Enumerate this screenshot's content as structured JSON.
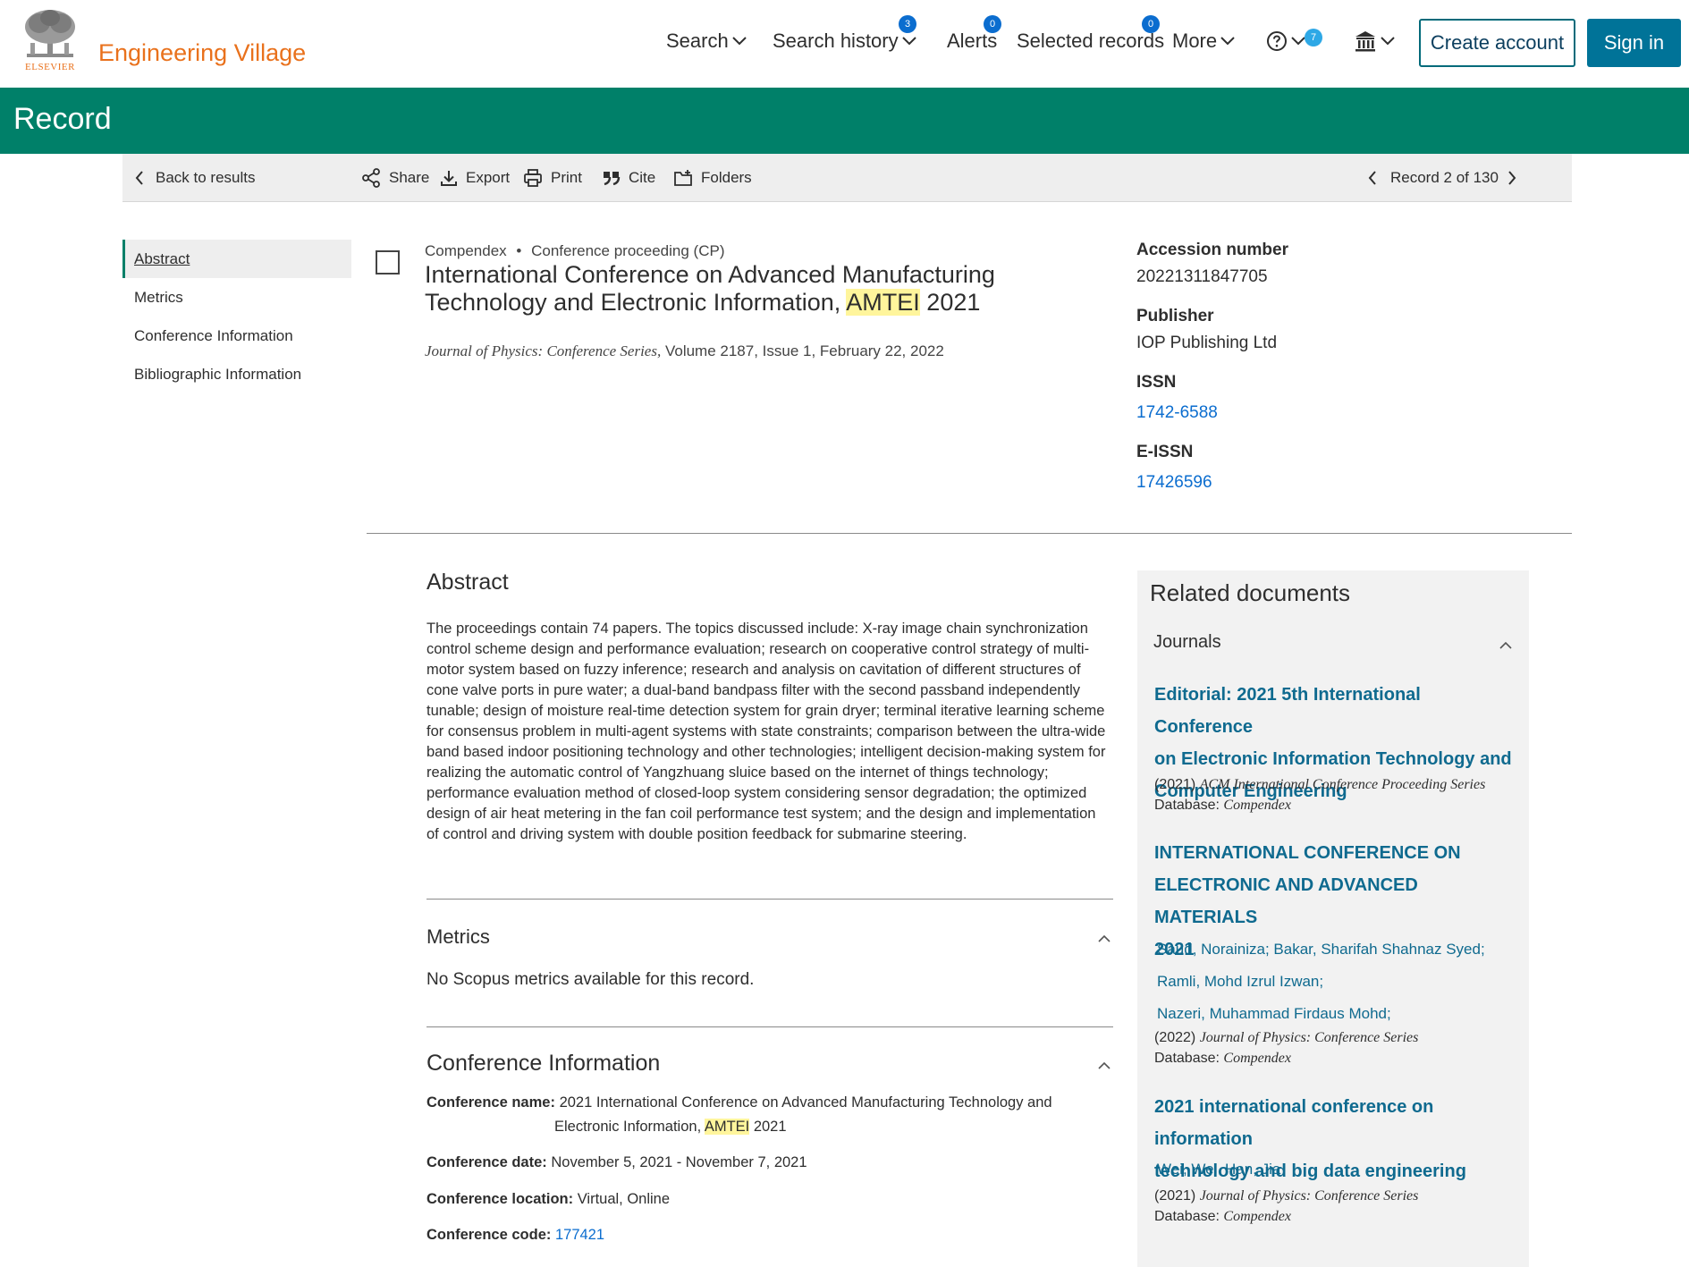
{
  "header": {
    "logo_text": "ELSEVIER",
    "brand": "Engineering Village",
    "nav": {
      "search": "Search",
      "search_history": "Search history",
      "search_history_badge": "3",
      "alerts": "Alerts",
      "alerts_badge": "0",
      "selected_records": "Selected records",
      "selected_records_badge": "0",
      "more": "More",
      "help_badge": "7"
    },
    "create_account": "Create account",
    "sign_in": "Sign in"
  },
  "band": {
    "title": "Record"
  },
  "toolbar": {
    "back": "Back to results",
    "share": "Share",
    "export": "Export",
    "print": "Print",
    "cite": "Cite",
    "folders": "Folders",
    "record_position": "Record 2 of 130"
  },
  "sidenav": {
    "items": [
      "Abstract",
      "Metrics",
      "Conference Information",
      "Bibliographic Information"
    ]
  },
  "record": {
    "database": "Compendex",
    "separator": "•",
    "doc_type": "Conference proceeding (CP)",
    "title_part1": "International Conference on Advanced Manufacturing Technology and Electronic Information, ",
    "title_hl": "AMTEI",
    "title_part2": " 2021",
    "journal": "Journal of Physics: Conference Series,",
    "journal_details": " Volume 2187, Issue 1, February 22, 2022"
  },
  "meta": {
    "accession_label": "Accession number",
    "accession_value": "20221311847705",
    "publisher_label": "Publisher",
    "publisher_value": "IOP Publishing Ltd",
    "issn_label": "ISSN",
    "issn_value": "1742-6588",
    "eissn_label": "E-ISSN",
    "eissn_value": "17426596"
  },
  "abstract": {
    "heading": "Abstract",
    "text": "The proceedings contain 74 papers. The topics discussed include: X-ray image chain synchronization control scheme design and performance evaluation; research on cooperative control strategy of multi-motor system based on fuzzy inference; research and analysis on cavitation of different structures of cone valve ports in pure water; a dual-band bandpass filter with the second passband independently tunable; design of moisture real-time detection system for grain dryer; terminal iterative learning scheme for consensus problem in multi-agent systems with state constraints; comparison between the ultra-wide band based indoor positioning technology and other technologies; intelligent decision-making system for realizing the automatic control of Yangzhuang sluice based on the internet of things technology; performance evaluation method of closed-loop system considering sensor degradation; the optimized design of air heat metering in the fan coil performance test system; and the design and implementation of control and driving system with double position feedback for submarine steering."
  },
  "metrics": {
    "heading": "Metrics",
    "text": "No Scopus metrics available for this record."
  },
  "conference": {
    "heading": "Conference Information",
    "name_label": "Conference name:",
    "name_part1": "2021 International Conference on Advanced Manufacturing Technology and",
    "name_part2": "Electronic Information, ",
    "name_hl": "AMTEI",
    "name_part3": " 2021",
    "date_label": "Conference date:",
    "date_value": "November 5, 2021 - November 7, 2021",
    "location_label": "Conference location:",
    "location_value": "Virtual, Online",
    "code_label": "Conference code:",
    "code_value": "177421"
  },
  "related": {
    "heading": "Related documents",
    "group": "Journals",
    "docs": [
      {
        "title_lines": [
          "Editorial: 2021 5th International Conference",
          "on Electronic Information Technology and",
          "Computer Engineering"
        ],
        "year": "(2021)",
        "source": "ACM International Conference Proceeding Series",
        "db_label": "Database:",
        "db": "Compendex"
      },
      {
        "title_lines": [
          "INTERNATIONAL CONFERENCE ON",
          "ELECTRONIC AND ADVANCED MATERIALS",
          "2021"
        ],
        "authors": [
          "Saud, Norainiza; Bakar, Sharifah Shahnaz Syed;",
          "Ramli, Mohd Izrul Izwan;",
          "Nazeri, Muhammad Firdaus Mohd;"
        ],
        "year": "(2022)",
        "source": "Journal of Physics: Conference Series",
        "db_label": "Database:",
        "db": "Compendex"
      },
      {
        "title_lines": [
          "2021 international conference on information",
          "technology and big data engineering"
        ],
        "authors": [
          "Wei, Wei",
          "Han, Jia"
        ],
        "year": "(2021)",
        "source": "Journal of Physics: Conference Series",
        "db_label": "Database:",
        "db": "Compendex"
      }
    ]
  },
  "colors": {
    "brand_orange": "#e9711c",
    "band_green": "#008069",
    "link_blue": "#0b6dcf",
    "related_title": "#0f6a8f",
    "sign_in_bg": "#007398",
    "highlight": "#fff59c"
  }
}
